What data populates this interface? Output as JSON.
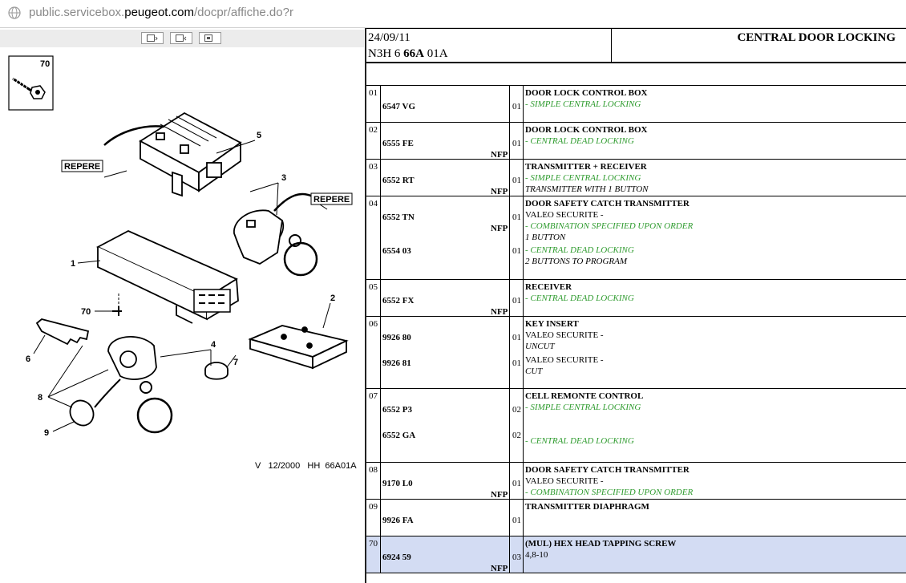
{
  "address_bar": {
    "url_prefix": "public.servicebox.",
    "url_domain": "peugeot.com",
    "url_suffix": "/docpr/affiche.do?r",
    "icon": "globe-icon"
  },
  "left_pane": {
    "toolbar_icons": [
      "zoom-in-icon",
      "zoom-out-icon",
      "print-icon"
    ],
    "inset_number": "70",
    "labels": {
      "l1": "1",
      "l2": "2",
      "l3": "3",
      "l4": "4",
      "l5": "5",
      "l6": "6",
      "l7": "7",
      "l8": "8",
      "l9": "9",
      "l70": "70",
      "repere1": "REPERE",
      "repere2": "REPERE"
    },
    "drawing_ref": "V   12/2000   HH  66A01A"
  },
  "header": {
    "date": "24/09/11",
    "code_prefix": "N3H 6 ",
    "code_bold": "66A",
    "code_suffix": " 01A",
    "title": "CENTRAL DOOR LOCKING"
  },
  "rows": [
    {
      "pos": "01",
      "highlight": false,
      "refs": [
        {
          "ref": "6547 VG",
          "nfp": "",
          "qty": "01"
        }
      ],
      "lines": [
        {
          "t": "DOOR LOCK CONTROL BOX",
          "s": "title"
        },
        {
          "t": "- SIMPLE CENTRAL LOCKING",
          "s": "green"
        }
      ]
    },
    {
      "pos": "02",
      "highlight": false,
      "refs": [
        {
          "ref": "6555 FE",
          "nfp": "NFP",
          "qty": "01"
        }
      ],
      "lines": [
        {
          "t": "DOOR LOCK CONTROL BOX",
          "s": "title"
        },
        {
          "t": "- CENTRAL DEAD LOCKING",
          "s": "green"
        }
      ]
    },
    {
      "pos": "03",
      "highlight": false,
      "refs": [
        {
          "ref": "6552 RT",
          "nfp": "NFP",
          "qty": "01"
        }
      ],
      "lines": [
        {
          "t": "TRANSMITTER + RECEIVER",
          "s": "title"
        },
        {
          "t": "- SIMPLE CENTRAL LOCKING",
          "s": "green"
        },
        {
          "t": "TRANSMITTER WITH 1 BUTTON",
          "s": "italic"
        }
      ]
    },
    {
      "pos": "04",
      "highlight": false,
      "refs": [
        {
          "ref": "6552 TN",
          "nfp": "NFP",
          "qty": "01"
        },
        {
          "ref": "6554 03",
          "nfp": "",
          "qty": "01"
        }
      ],
      "lines": [
        {
          "t": "DOOR SAFETY CATCH TRANSMITTER",
          "s": "title"
        },
        {
          "t": "VALEO SECURITE -",
          "s": "plain"
        },
        {
          "t": "- COMBINATION SPECIFIED UPON ORDER",
          "s": "green"
        },
        {
          "t": "1 BUTTON",
          "s": "italic"
        },
        {
          "t": "- CENTRAL DEAD LOCKING",
          "s": "green"
        },
        {
          "t": "2 BUTTONS TO PROGRAM",
          "s": "italic"
        }
      ]
    },
    {
      "pos": "05",
      "highlight": false,
      "refs": [
        {
          "ref": "6552 FX",
          "nfp": "NFP",
          "qty": "01"
        }
      ],
      "lines": [
        {
          "t": "RECEIVER",
          "s": "title"
        },
        {
          "t": "- CENTRAL DEAD LOCKING",
          "s": "green"
        }
      ]
    },
    {
      "pos": "06",
      "highlight": false,
      "refs": [
        {
          "ref": "9926 80",
          "nfp": "",
          "qty": "01"
        },
        {
          "ref": "9926 81",
          "nfp": "",
          "qty": "01"
        }
      ],
      "lines": [
        {
          "t": "KEY INSERT",
          "s": "title"
        },
        {
          "t": "VALEO SECURITE -",
          "s": "plain"
        },
        {
          "t": "UNCUT",
          "s": "italic"
        },
        {
          "t": "",
          "s": "plain"
        },
        {
          "t": "VALEO SECURITE -",
          "s": "plain"
        },
        {
          "t": "CUT",
          "s": "italic"
        }
      ]
    },
    {
      "pos": "07",
      "highlight": false,
      "refs": [
        {
          "ref": "6552 P3",
          "nfp": "",
          "qty": "02"
        },
        {
          "ref": "6552 GA",
          "nfp": "",
          "qty": "02"
        }
      ],
      "lines": [
        {
          "t": "CELL REMONTE CONTROL",
          "s": "title"
        },
        {
          "t": "- SIMPLE CENTRAL LOCKING",
          "s": "green"
        },
        {
          "t": "",
          "s": "plain"
        },
        {
          "t": "",
          "s": "plain"
        },
        {
          "t": "- CENTRAL DEAD LOCKING",
          "s": "green"
        }
      ]
    },
    {
      "pos": "08",
      "highlight": false,
      "refs": [
        {
          "ref": "9170 L0",
          "nfp": "NFP",
          "qty": "01"
        }
      ],
      "lines": [
        {
          "t": "DOOR SAFETY CATCH TRANSMITTER",
          "s": "title"
        },
        {
          "t": "VALEO SECURITE -",
          "s": "plain"
        },
        {
          "t": "- COMBINATION SPECIFIED UPON ORDER",
          "s": "green"
        }
      ]
    },
    {
      "pos": "09",
      "highlight": false,
      "refs": [
        {
          "ref": "9926 FA",
          "nfp": "",
          "qty": "01"
        }
      ],
      "lines": [
        {
          "t": "TRANSMITTER DIAPHRAGM",
          "s": "title"
        }
      ]
    },
    {
      "pos": "70",
      "highlight": true,
      "refs": [
        {
          "ref": "6924 59",
          "nfp": "NFP",
          "qty": "03"
        }
      ],
      "lines": [
        {
          "t": "(MUL) HEX HEAD TAPPING SCREW",
          "s": "title"
        },
        {
          "t": "4,8-10",
          "s": "plain"
        }
      ]
    }
  ]
}
